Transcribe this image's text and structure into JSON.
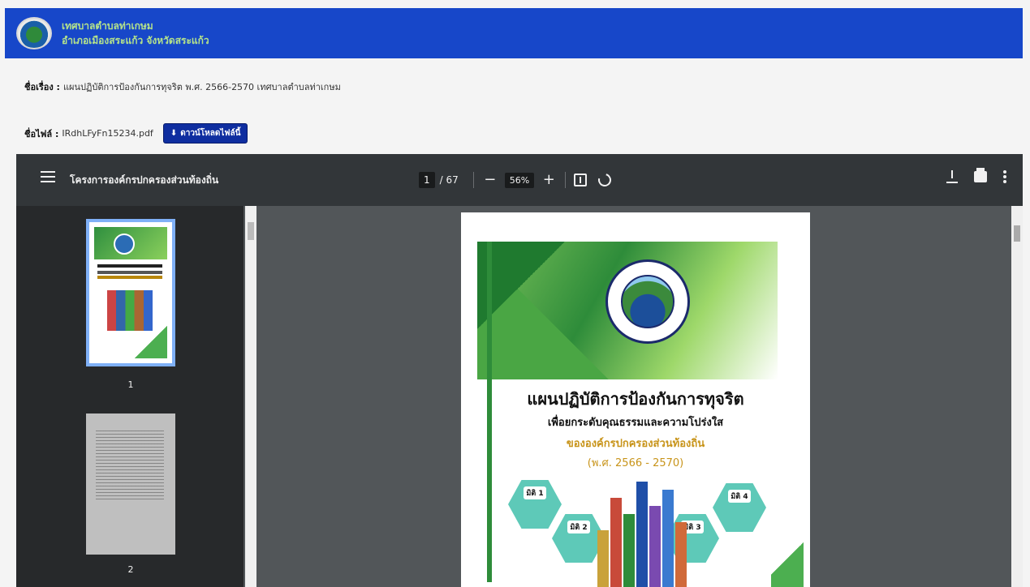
{
  "header": {
    "site_name": "เทศบาลตำบลท่าเกษม",
    "site_subtitle": "อำเภอเมืองสระแก้ว จังหวัดสระแก้ว"
  },
  "meta": {
    "title_label": "ชื่อเรื่อง :",
    "title_value": "แผนปฏิบัติการป้องกันการทุจริต พ.ศ. 2566-2570 เทศบาลตำบลท่าเกษม",
    "file_label": "ชื่อไฟล์ :",
    "file_value": "IRdhLFyFn15234.pdf",
    "download_label": "ดาวน์โหลดไฟล์นี้"
  },
  "viewer": {
    "doc_title": "โครงการองค์กรปกครองส่วนท้องถิ่น",
    "current_page": "1",
    "total_pages": "/ 67",
    "zoom_out": "−",
    "zoom": "56%",
    "zoom_in": "+",
    "thumbnails": [
      {
        "label": "1"
      },
      {
        "label": "2"
      }
    ]
  },
  "cover": {
    "title": "แผนปฏิบัติการป้องกันการทุจริต",
    "subtitle": "เพื่อยกระดับคุณธรรมและความโปร่งใส",
    "org": "ขององค์กรปกครองส่วนท้องถิ่น",
    "years": "(พ.ศ. 2566 - 2570)",
    "hexes": [
      "มิติ 1",
      "มิติ 2",
      "มิติ 3",
      "มิติ 4"
    ]
  }
}
